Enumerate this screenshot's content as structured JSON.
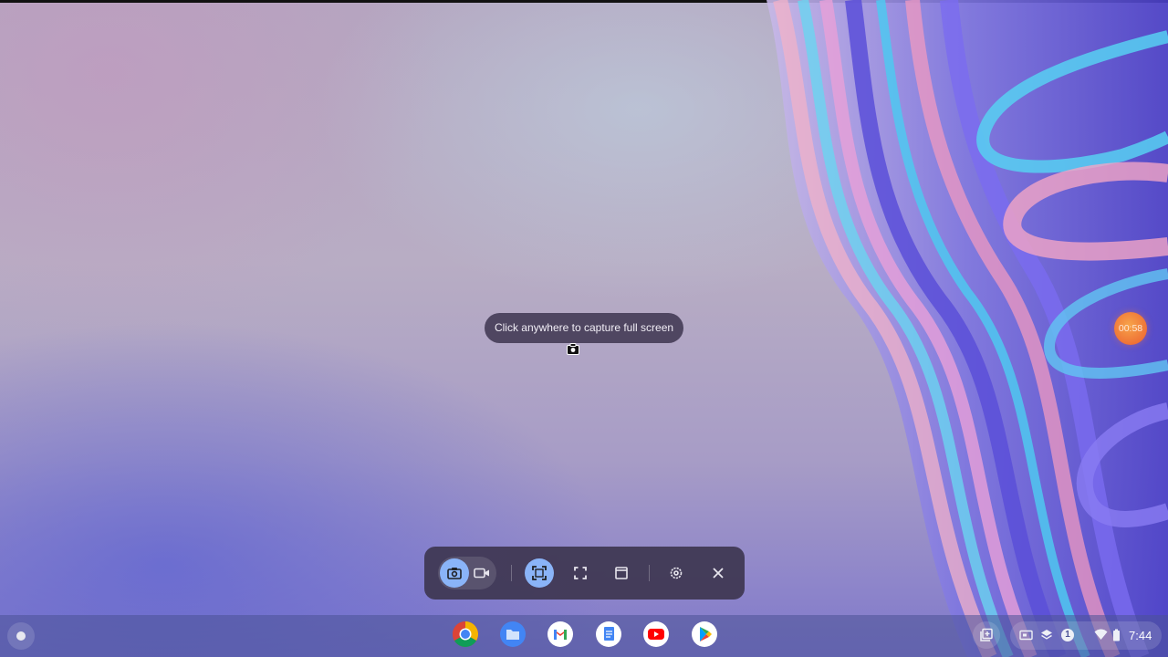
{
  "overlay": {
    "tooltip": "Click anywhere to capture full screen",
    "recording_timer": "00:58"
  },
  "capture_bar": {
    "type_options": [
      "screenshot",
      "screen-record"
    ],
    "selected_type": "screenshot",
    "source_options": [
      "fullscreen",
      "partial",
      "window"
    ],
    "selected_source": "fullscreen"
  },
  "shelf": {
    "apps": [
      "Chrome",
      "Files",
      "Gmail",
      "Docs",
      "YouTube",
      "Play Store"
    ],
    "notification_count": "1",
    "time": "7:44"
  },
  "colors": {
    "accent": "#8ab4f8",
    "capture_bar_bg": "#3e3752",
    "timer_orange": "#ee6f35"
  }
}
